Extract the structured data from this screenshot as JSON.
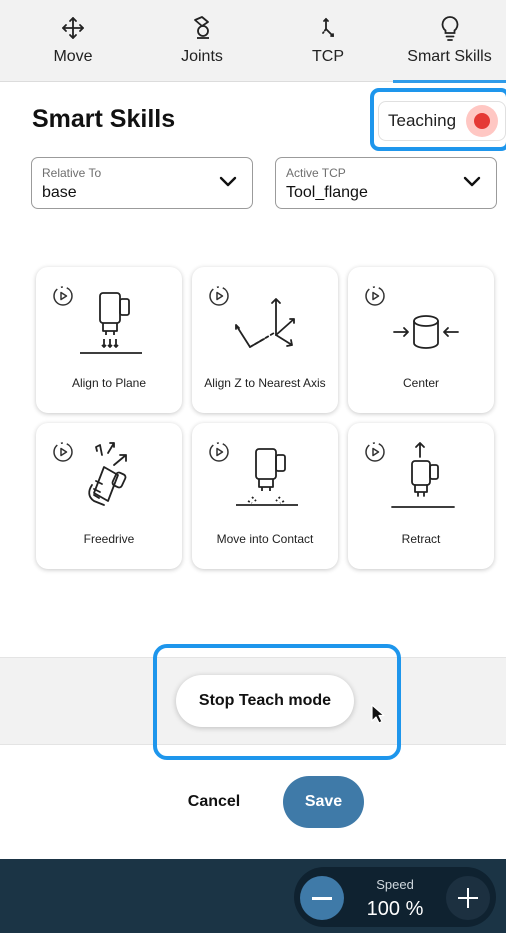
{
  "tabs": [
    {
      "label": "Move",
      "icon": "move-arrows-icon"
    },
    {
      "label": "Joints",
      "icon": "robot-joint-icon"
    },
    {
      "label": "TCP",
      "icon": "tcp-axes-icon"
    },
    {
      "label": "Smart Skills",
      "icon": "lightbulb-icon",
      "active": true
    }
  ],
  "page": {
    "title": "Smart Skills"
  },
  "teaching": {
    "label": "Teaching",
    "status_color": "#e53935"
  },
  "relative_to": {
    "label": "Relative To",
    "value": "base"
  },
  "active_tcp": {
    "label": "Active TCP",
    "value": "Tool_flange"
  },
  "skills": [
    {
      "name": "Align to Plane",
      "icon": "align-to-plane-icon"
    },
    {
      "name": "Align Z to Nearest Axis",
      "icon": "align-z-axis-icon"
    },
    {
      "name": "Center",
      "icon": "center-icon"
    },
    {
      "name": "Freedrive",
      "icon": "freedrive-icon"
    },
    {
      "name": "Move into Contact",
      "icon": "move-into-contact-icon"
    },
    {
      "name": "Retract",
      "icon": "retract-icon"
    }
  ],
  "teach_mode": {
    "stop_label": "Stop Teach mode"
  },
  "actions": {
    "cancel_label": "Cancel",
    "save_label": "Save"
  },
  "speed": {
    "label": "Speed",
    "value": "100 %"
  },
  "colors": {
    "accent": "#1e96ec",
    "primary_button": "#3f7aa8",
    "bottom_bar": "#1b3445"
  }
}
